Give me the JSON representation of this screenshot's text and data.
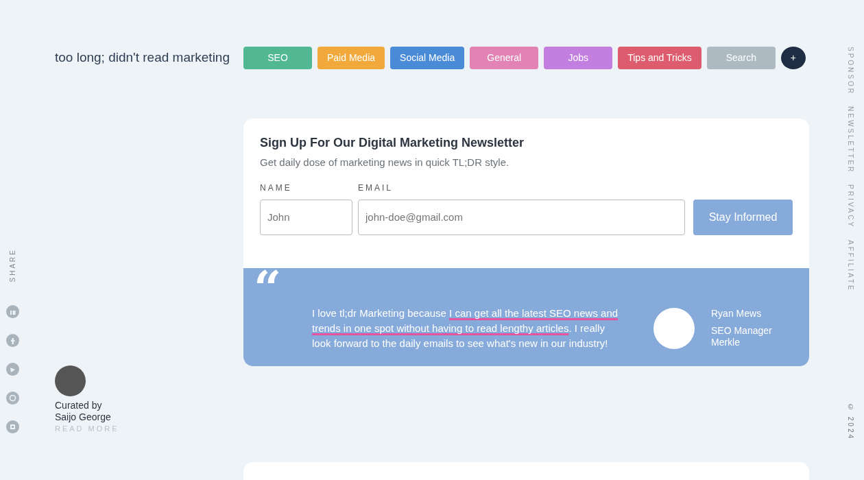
{
  "brand": "too long; didn't read marketing",
  "categories": [
    {
      "label": "SEO",
      "color": "#52b893"
    },
    {
      "label": "Paid Media",
      "color": "#f2a93b"
    },
    {
      "label": "Social Media",
      "color": "#4a8bd8"
    },
    {
      "label": "General",
      "color": "#e282b5"
    },
    {
      "label": "Jobs",
      "color": "#c27fdf"
    },
    {
      "label": "Tips and Tricks",
      "color": "#dd5c6e"
    },
    {
      "label": "Search",
      "color": "#adbac2"
    },
    {
      "label": "+",
      "color": "#1f2d44"
    }
  ],
  "share": {
    "label": "SHARE"
  },
  "right_links": [
    "SPONSOR",
    "NEWSLETTER",
    "PRIVACY",
    "AFFILIATE"
  ],
  "copyright": "© 2024",
  "curator": {
    "line1": "Curated by",
    "line2": "Saijo George",
    "link": "READ MORE"
  },
  "newsletter": {
    "title": "Sign Up For Our Digital Marketing Newsletter",
    "subtitle": "Get daily dose of marketing news in quick TL;DR style.",
    "fields": [
      {
        "label": "NAME",
        "placeholder": "John"
      },
      {
        "label": "EMAIL",
        "placeholder": "john-doe@gmail.com"
      }
    ],
    "button": "Stay Informed"
  },
  "testimonial": {
    "quote_mark": "“",
    "before": "I love tl;dr Marketing because ",
    "highlight": "I can get all the latest SEO news and trends in one spot without having to read lengthy articles",
    "after": ". I really look forward to the daily emails to see what's new in our industry!",
    "name": "Ryan Mews",
    "role": "SEO Manager",
    "company": "Merkle"
  }
}
